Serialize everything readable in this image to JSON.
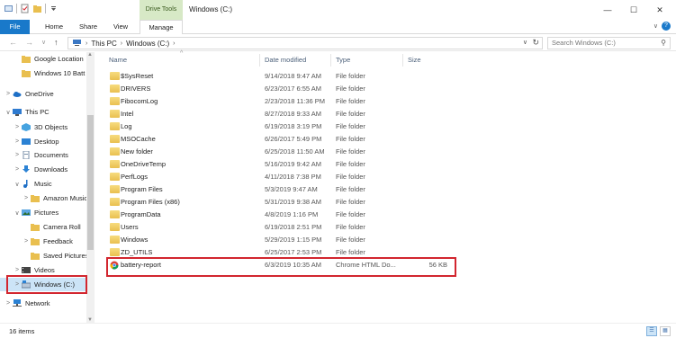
{
  "window": {
    "title": "Windows (C:)",
    "context_tab": "Drive Tools",
    "controls": {
      "minimize": "—",
      "maximize": "☐",
      "close": "✕"
    }
  },
  "ribbon": {
    "tabs": [
      "File",
      "Home",
      "Share",
      "View",
      "Manage"
    ],
    "expand_icon": "∨",
    "help_icon": "?"
  },
  "address_bar": {
    "back": "←",
    "forward": "→",
    "recent": "∨",
    "up": "↑",
    "crumbs": [
      "This PC",
      "Windows (C:)"
    ],
    "search_placeholder": "Search Windows (C:)"
  },
  "nav_pane": {
    "items": [
      {
        "label": "Google Location",
        "icon": "folder-icon",
        "chevron": "",
        "indent": 1
      },
      {
        "label": "Windows 10 Batt",
        "icon": "folder-icon",
        "chevron": "",
        "indent": 1
      },
      {
        "label": "OneDrive",
        "icon": "onedrive-icon",
        "chevron": ">",
        "indent": 0
      },
      {
        "label": "This PC",
        "icon": "pc-icon",
        "chevron": "∨",
        "indent": 0
      },
      {
        "label": "3D Objects",
        "icon": "3d-objects-icon",
        "chevron": ">",
        "indent": 1
      },
      {
        "label": "Desktop",
        "icon": "desktop-icon",
        "chevron": ">",
        "indent": 1
      },
      {
        "label": "Documents",
        "icon": "documents-icon",
        "chevron": ">",
        "indent": 1
      },
      {
        "label": "Downloads",
        "icon": "downloads-icon",
        "chevron": ">",
        "indent": 1
      },
      {
        "label": "Music",
        "icon": "music-icon",
        "chevron": "∨",
        "indent": 1
      },
      {
        "label": "Amazon Music",
        "icon": "folder-icon",
        "chevron": ">",
        "indent": 2
      },
      {
        "label": "Pictures",
        "icon": "pictures-icon",
        "chevron": "∨",
        "indent": 1
      },
      {
        "label": "Camera Roll",
        "icon": "folder-icon",
        "chevron": "",
        "indent": 2
      },
      {
        "label": "Feedback",
        "icon": "folder-icon",
        "chevron": ">",
        "indent": 2
      },
      {
        "label": "Saved Pictures",
        "icon": "folder-icon",
        "chevron": "",
        "indent": 2
      },
      {
        "label": "Videos",
        "icon": "videos-icon",
        "chevron": ">",
        "indent": 1
      },
      {
        "label": "Windows (C:)",
        "icon": "drive-icon",
        "chevron": ">",
        "indent": 1,
        "selected": true
      },
      {
        "label": "Network",
        "icon": "network-icon",
        "chevron": ">",
        "indent": 0
      }
    ]
  },
  "file_list": {
    "columns": [
      "Name",
      "Date modified",
      "Type",
      "Size"
    ],
    "rows": [
      {
        "name": "$SysReset",
        "date": "9/14/2018 9:47 AM",
        "type": "File folder",
        "size": ""
      },
      {
        "name": "DRIVERS",
        "date": "6/23/2017 6:55 AM",
        "type": "File folder",
        "size": ""
      },
      {
        "name": "FibocomLog",
        "date": "2/23/2018 11:36 PM",
        "type": "File folder",
        "size": ""
      },
      {
        "name": "Intel",
        "date": "8/27/2018 9:33 AM",
        "type": "File folder",
        "size": ""
      },
      {
        "name": "Log",
        "date": "6/19/2018 3:19 PM",
        "type": "File folder",
        "size": ""
      },
      {
        "name": "MSOCache",
        "date": "6/26/2017 5:49 PM",
        "type": "File folder",
        "size": ""
      },
      {
        "name": "New folder",
        "date": "6/25/2018 11:50 AM",
        "type": "File folder",
        "size": ""
      },
      {
        "name": "OneDriveTemp",
        "date": "5/16/2019 9:42 AM",
        "type": "File folder",
        "size": ""
      },
      {
        "name": "PerfLogs",
        "date": "4/11/2018 7:38 PM",
        "type": "File folder",
        "size": ""
      },
      {
        "name": "Program Files",
        "date": "5/3/2019 9:47 AM",
        "type": "File folder",
        "size": ""
      },
      {
        "name": "Program Files (x86)",
        "date": "5/31/2019 9:38 AM",
        "type": "File folder",
        "size": ""
      },
      {
        "name": "ProgramData",
        "date": "4/8/2019 1:16 PM",
        "type": "File folder",
        "size": ""
      },
      {
        "name": "Users",
        "date": "6/19/2018 2:51 PM",
        "type": "File folder",
        "size": ""
      },
      {
        "name": "Windows",
        "date": "5/29/2019 1:15 PM",
        "type": "File folder",
        "size": ""
      },
      {
        "name": "ZD_UTILS",
        "date": "6/25/2017 2:53 PM",
        "type": "File folder",
        "size": ""
      },
      {
        "name": "battery-report",
        "date": "6/3/2019 10:35 AM",
        "type": "Chrome HTML Do...",
        "size": "56 KB",
        "icon": "chrome-icon"
      }
    ]
  },
  "status_bar": {
    "item_count": "16 items"
  },
  "colors": {
    "file_tab": "#1979ca",
    "drive_tools": "#d7e9c6",
    "selection": "#cce4f7",
    "highlight_box": "#d2262f",
    "folder": "#e9bf4f"
  }
}
